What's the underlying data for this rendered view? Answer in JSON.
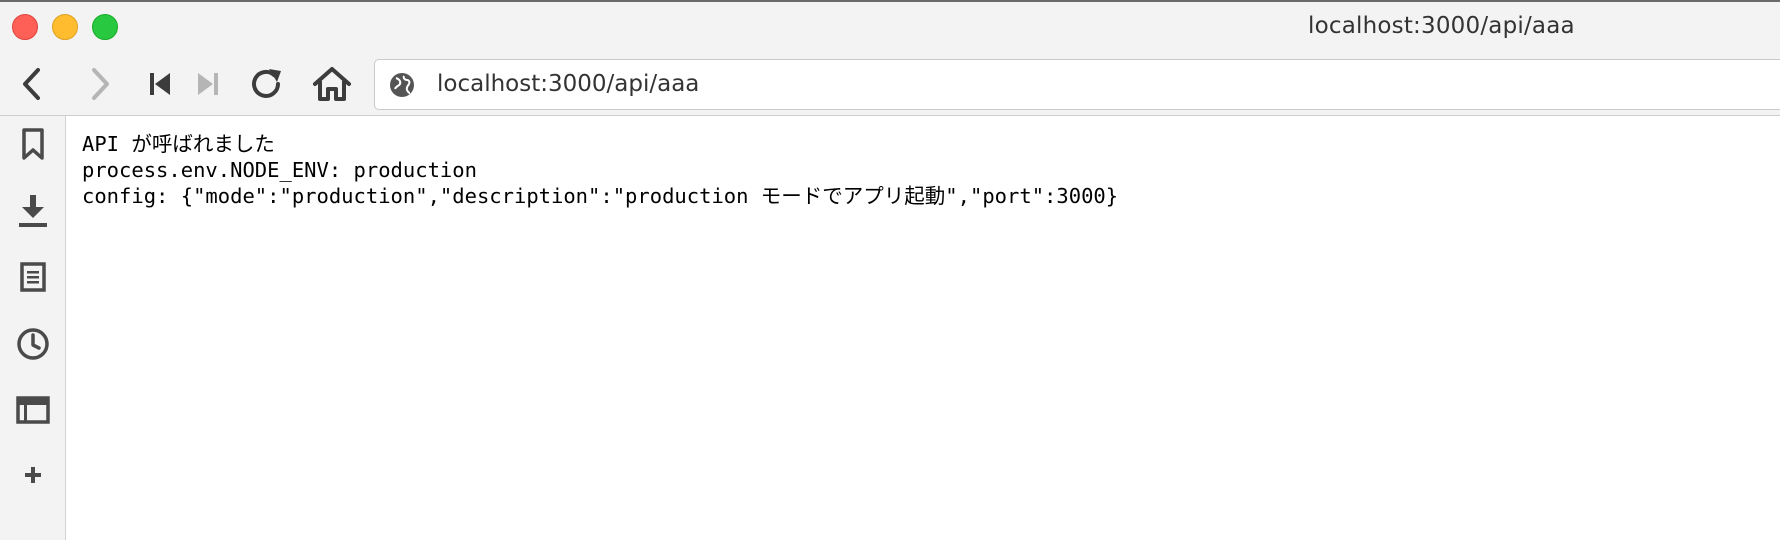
{
  "window": {
    "title": "localhost:3000/api/aaa"
  },
  "toolbar": {
    "buttons": [
      {
        "name": "back",
        "icon": "chevron-left-icon",
        "enabled": true
      },
      {
        "name": "forward",
        "icon": "chevron-right-icon",
        "enabled": false
      },
      {
        "name": "first",
        "icon": "skip-back-icon",
        "enabled": true
      },
      {
        "name": "last",
        "icon": "skip-forward-icon",
        "enabled": false
      },
      {
        "name": "reload",
        "icon": "reload-icon",
        "enabled": true
      },
      {
        "name": "home",
        "icon": "home-icon",
        "enabled": true
      }
    ],
    "url": "localhost:3000/api/aaa",
    "url_icon": "globe-icon"
  },
  "sidebar": {
    "items": [
      {
        "name": "bookmarks",
        "icon": "bookmark-icon"
      },
      {
        "name": "downloads",
        "icon": "download-icon"
      },
      {
        "name": "notes",
        "icon": "notes-icon"
      },
      {
        "name": "history",
        "icon": "clock-icon"
      },
      {
        "name": "window",
        "icon": "window-icon"
      },
      {
        "name": "add",
        "icon": "plus-icon",
        "label": "+"
      }
    ]
  },
  "content": {
    "lines": [
      "API が呼ばれました",
      "process.env.NODE_ENV: production",
      "config: {\"mode\":\"production\",\"description\":\"production モードでアプリ起動\",\"port\":3000}"
    ]
  },
  "colors": {
    "close": "#fe5f57",
    "minimize": "#febc2e",
    "maximize": "#28c840",
    "chrome": "#f3f3f3",
    "icon": "#4a4a4a",
    "icon_disabled": "#b5b5b5"
  }
}
